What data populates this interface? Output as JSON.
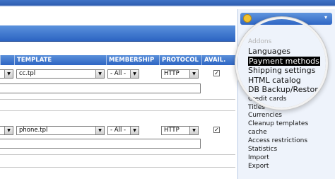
{
  "table": {
    "columns": [
      "TEMPLATE",
      "MEMBERSHIP",
      "PROTOCOL",
      "AVAIL."
    ],
    "rows": [
      {
        "template": "cc.tpl",
        "membership": "- All -",
        "protocol": "HTTP",
        "avail": "✓"
      },
      {
        "template": "phone.tpl",
        "membership": "- All -",
        "protocol": "HTTP",
        "avail": "✓"
      }
    ]
  },
  "menu": {
    "caret": "▾",
    "items": [
      {
        "label": "Addons",
        "state": "faded"
      },
      {
        "label": "Languages",
        "state": "magnified"
      },
      {
        "label": "Payment methods",
        "state": "selected"
      },
      {
        "label": "Shipping settings",
        "state": "magnified"
      },
      {
        "label": "HTML catalog",
        "state": "magnified"
      },
      {
        "label": "DB Backup/Restor",
        "state": "magnified"
      },
      {
        "label": "Credit cards",
        "state": "normal"
      },
      {
        "label": "Titles",
        "state": "normal"
      },
      {
        "label": "Currencies",
        "state": "normal"
      },
      {
        "label": "Cleanup templates",
        "state": "normal"
      },
      {
        "label": "cache",
        "state": "normal"
      },
      {
        "label": "Access restrictions",
        "state": "normal"
      },
      {
        "label": "Statistics",
        "state": "normal"
      },
      {
        "label": "Import",
        "state": "normal"
      },
      {
        "label": "Export",
        "state": "normal"
      }
    ]
  },
  "colors": {
    "header_blue": "#2c64c2",
    "selected_bg": "#000000"
  }
}
